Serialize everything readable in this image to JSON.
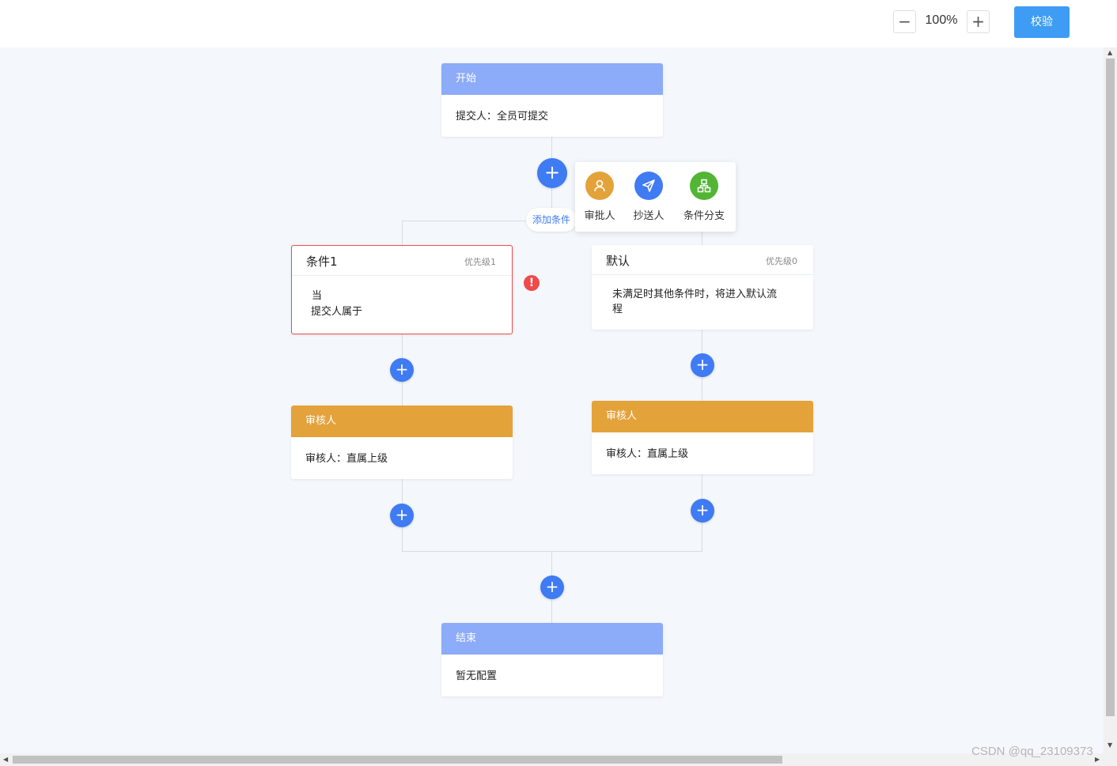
{
  "toolbar": {
    "zoom_out_glyph": "−",
    "zoom_level": "100%",
    "zoom_in_glyph": "+",
    "verify_label": "校验"
  },
  "start_node": {
    "title": "开始",
    "content": "提交人：全员可提交"
  },
  "add_condition_label": "添加条件",
  "add_menu": {
    "items": [
      {
        "label": "审批人",
        "icon": "user-icon",
        "color": "#e4a23b"
      },
      {
        "label": "抄送人",
        "icon": "send-icon",
        "color": "#3f7bf3"
      },
      {
        "label": "条件分支",
        "icon": "branch-icon",
        "color": "#52b534"
      }
    ]
  },
  "conditions": [
    {
      "title": "条件1",
      "priority": "优先级1",
      "line1": "当",
      "line2": "提交人属于",
      "has_error": true
    },
    {
      "title": "默认",
      "priority": "优先级0",
      "line1": "未满足时其他条件时，将进入默认流",
      "line2": "程",
      "has_error": false
    }
  ],
  "reviewers": [
    {
      "title": "审核人",
      "content": "审核人：直属上级"
    },
    {
      "title": "审核人",
      "content": "审核人：直属上级"
    }
  ],
  "end_node": {
    "title": "结束",
    "content": "暂无配置"
  },
  "plus_glyph": "+",
  "error_glyph": "!",
  "watermark": "CSDN @qq_23109373",
  "colors": {
    "primary": "#3f7bf3",
    "header_blue": "#8cabf8",
    "header_orange": "#e4a23b",
    "error": "#ee4b4b",
    "verify_button": "#3e9cf5",
    "canvas_bg": "#f4f7fc"
  }
}
